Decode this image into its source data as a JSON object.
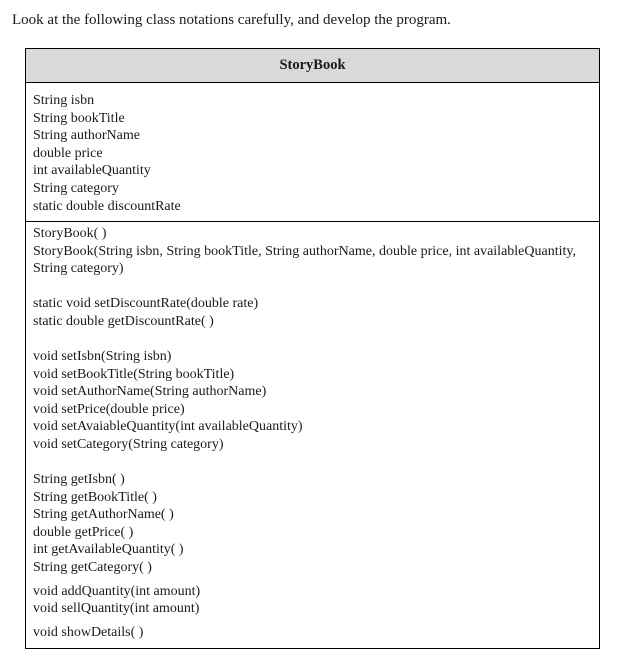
{
  "intro_text": "Look at the following class notations carefully, and develop the program.",
  "class_diagram": {
    "class_name": "StoryBook",
    "attributes": [
      "String isbn",
      "String bookTitle",
      "String authorName",
      "double price",
      "int availableQuantity",
      "String category",
      "static double discountRate"
    ],
    "constructors": [
      "StoryBook( )",
      "StoryBook(String isbn, String bookTitle, String authorName, double price, int availableQuantity, String category)"
    ],
    "static_methods": [
      "static void setDiscountRate(double rate)",
      "static double getDiscountRate( )"
    ],
    "setters": [
      "void setIsbn(String isbn)",
      "void setBookTitle(String bookTitle)",
      "void setAuthorName(String authorName)",
      "void setPrice(double price)",
      "void setAvaiableQuantity(int availableQuantity)",
      "void setCategory(String category)"
    ],
    "getters": [
      "String getIsbn( )",
      "String getBookTitle( )",
      "String getAuthorName( )",
      "double getPrice( )",
      "int getAvailableQuantity( )",
      "String getCategory( )"
    ],
    "quantity_methods": [
      "void addQuantity(int amount)",
      "void sellQuantity(int amount)"
    ],
    "other_methods": [
      "void showDetails( )"
    ]
  }
}
